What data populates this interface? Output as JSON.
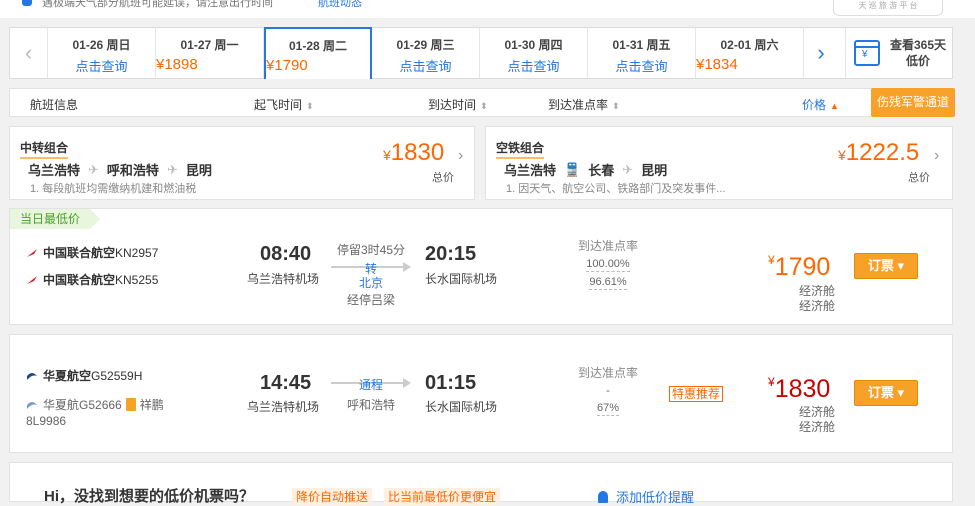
{
  "notice": {
    "text": "遇极端天气部分航班可能延误，请注意出行时间",
    "link": "航班动态",
    "logo_text": "天 巡 旅 游 平 台"
  },
  "datebar": {
    "dates": [
      {
        "date": "01-26 周日",
        "price": "点击查询",
        "has_price": false
      },
      {
        "date": "01-27 周一",
        "price": "¥1898",
        "has_price": true
      },
      {
        "date": "01-28 周二",
        "price": "¥1790",
        "has_price": true,
        "active": true
      },
      {
        "date": "01-29 周三",
        "price": "点击查询",
        "has_price": false
      },
      {
        "date": "01-30 周四",
        "price": "点击查询",
        "has_price": false
      },
      {
        "date": "01-31 周五",
        "price": "点击查询",
        "has_price": false
      },
      {
        "date": "02-01 周六",
        "price": "¥1834",
        "has_price": true
      }
    ],
    "calendar_label_1": "查看365天",
    "calendar_label_2": "低价",
    "calendar_icon_text": "¥"
  },
  "sortbar": {
    "flight_info": "航班信息",
    "dep_time": "起飞时间",
    "arr_time": "到达时间",
    "on_time": "到达准点率",
    "price": "价格",
    "military": "伤残军警通道"
  },
  "combos": [
    {
      "title": "中转组合",
      "stops": [
        "乌兰浩特",
        "呼和浩特",
        "昆明"
      ],
      "note": "1. 每段航班均需缴纳机建和燃油税",
      "price": "1830",
      "total": "总价",
      "mode_icon": "plane-icon"
    },
    {
      "title": "空铁组合",
      "stops": [
        "乌兰浩特",
        "长春",
        "昆明"
      ],
      "note": "1. 因天气、航空公司、铁路部门及突发事件...",
      "price": "1222.5",
      "total": "总价",
      "mode_icon": "train-icon"
    }
  ],
  "flights": [
    {
      "tag": "当日最低价",
      "airlines": [
        {
          "name": "中国联合航空",
          "code": "KN2957"
        },
        {
          "name": "中国联合航空",
          "code": "KN5255"
        }
      ],
      "dep_time": "08:40",
      "dep_airport": "乌兰浩特机场",
      "stop_info": "停留3时45分",
      "transfer_label": "转",
      "transfer_city": "北京",
      "via": "经停吕梁",
      "arr_time": "20:15",
      "arr_airport": "长水国际机场",
      "otp_header": "到达准点率",
      "otp_values": [
        "100.00%",
        "96.61%"
      ],
      "price": "1790",
      "cabins": [
        "经济舱",
        "经济舱"
      ],
      "book": "订票"
    },
    {
      "airlines": [
        {
          "name": "华夏航空",
          "code": "G52559H"
        },
        {
          "name": "华夏航",
          "code": "G52666",
          "extra": "祥鹏",
          "extra2": "8L9986"
        }
      ],
      "dep_time": "14:45",
      "dep_airport": "乌兰浩特机场",
      "stop_label": "通程",
      "stop_city": "呼和浩特",
      "arr_time": "01:15",
      "arr_airport": "长水国际机场",
      "otp_header": "到达准点率",
      "otp_values": [
        "-",
        "67%"
      ],
      "badge": "特惠推荐",
      "price": "1830",
      "cabins": [
        "经济舱",
        "经济舱"
      ],
      "book": "订票"
    }
  ],
  "bottom": {
    "question": "Hi，没找到想要的低价机票吗？",
    "tag1": "降价自动推送",
    "tag2": "比当前最低价更便宜",
    "action": "添加低价提醒"
  },
  "colors": {
    "accent": "#2577e3",
    "price": "#ff6600",
    "button": "#f7a128",
    "tag_bg": "#e7f6dd"
  }
}
